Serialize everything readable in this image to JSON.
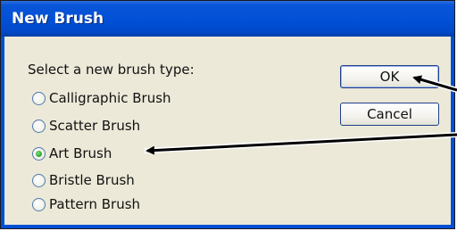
{
  "window": {
    "title": "New Brush"
  },
  "prompt": "Select a new brush type:",
  "options": [
    {
      "label": "Calligraphic Brush",
      "checked": false
    },
    {
      "label": "Scatter Brush",
      "checked": false
    },
    {
      "label": "Art Brush",
      "checked": true
    },
    {
      "label": "Bristle Brush",
      "checked": false
    },
    {
      "label": "Pattern Brush",
      "checked": false
    }
  ],
  "buttons": {
    "ok": "OK",
    "cancel": "Cancel"
  },
  "colors": {
    "titlebar": "#0050d6",
    "dialog_bg": "#ece9d8",
    "arrow": "#000000"
  }
}
